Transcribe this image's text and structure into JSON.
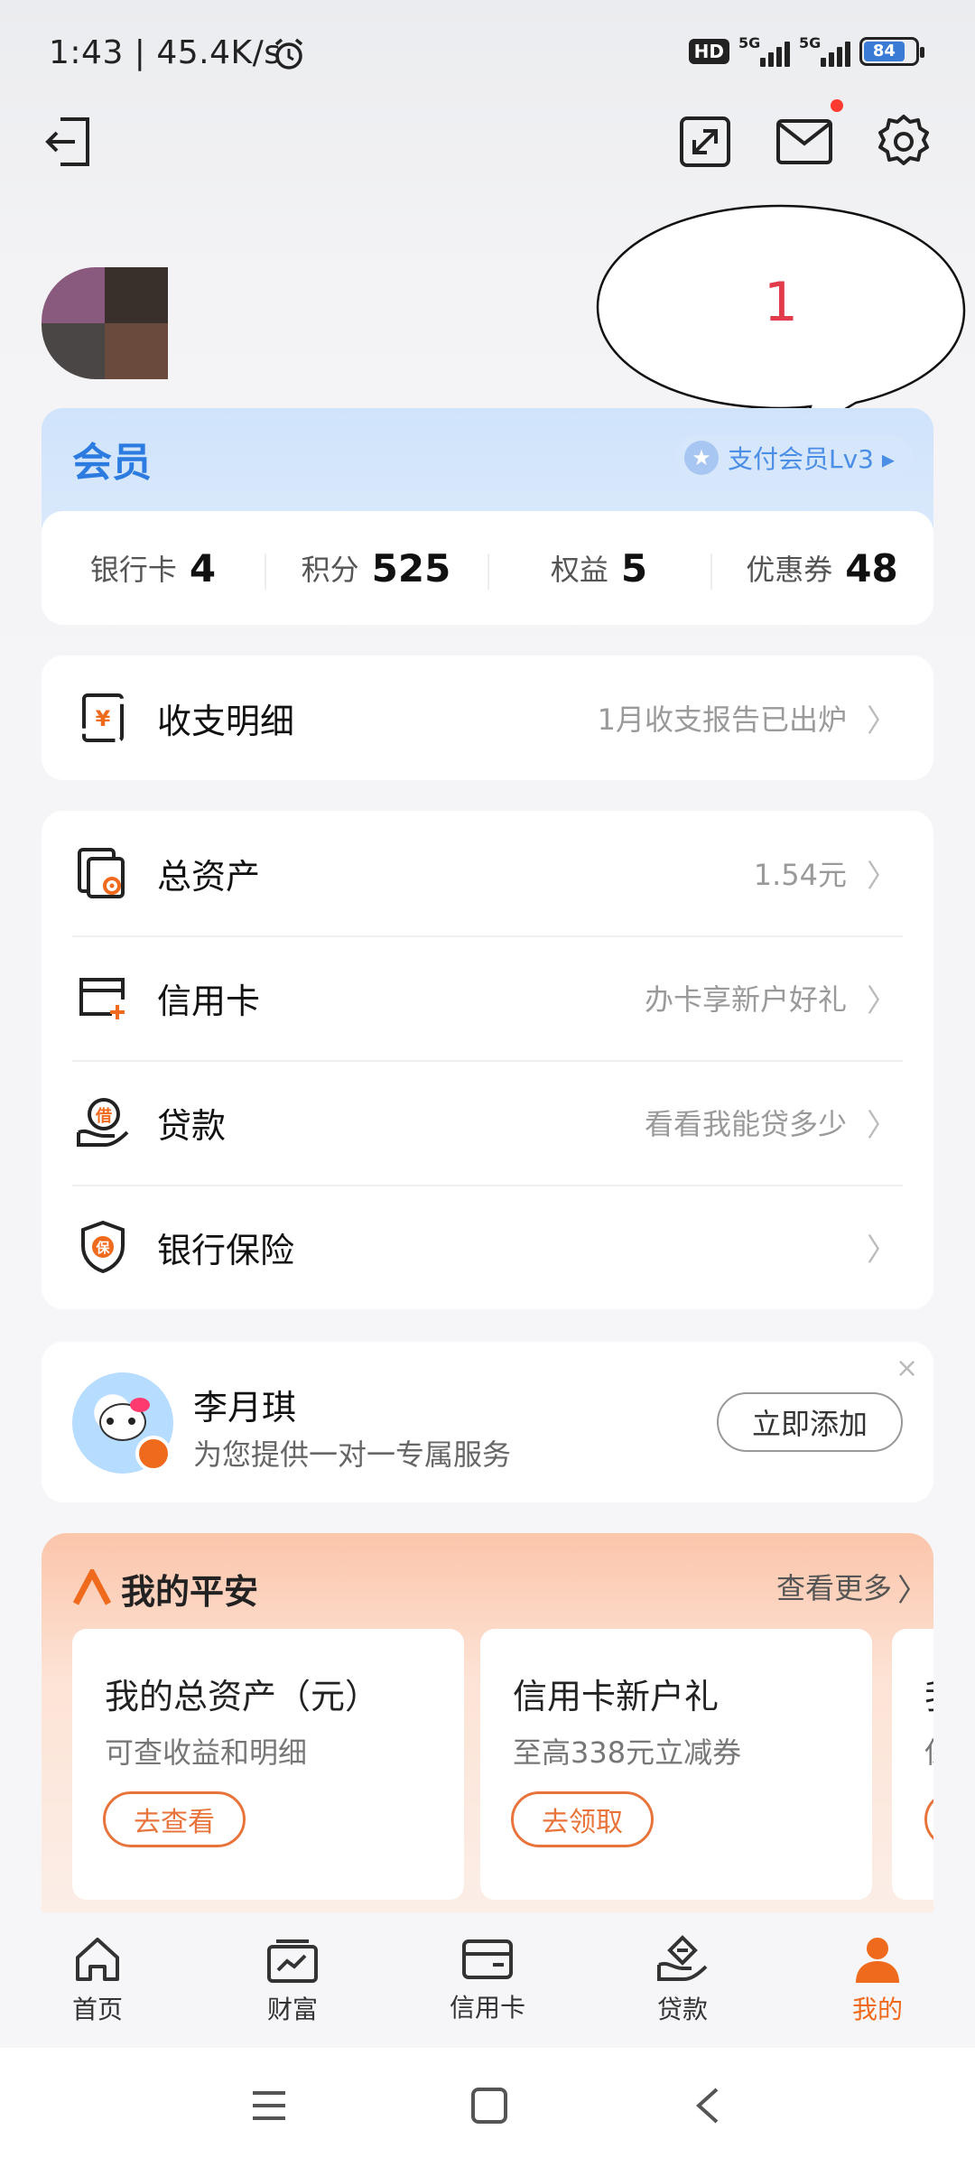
{
  "status_bar": {
    "time": "1:43 | 45.4K/s",
    "hd_label": "HD",
    "net1": "5G",
    "net2": "5G",
    "battery": "84"
  },
  "bubble": {
    "text": "1"
  },
  "member": {
    "title": "会员",
    "level": "支付会员Lv3 ▸",
    "stats": [
      {
        "label": "银行卡",
        "value": "4"
      },
      {
        "label": "积分",
        "value": "525"
      },
      {
        "label": "权益",
        "value": "5"
      },
      {
        "label": "优惠券",
        "value": "48"
      }
    ]
  },
  "statement": {
    "title": "收支明细",
    "hint": "1月收支报告已出炉"
  },
  "menu": [
    {
      "title": "总资产",
      "hint": "1.54元"
    },
    {
      "title": "信用卡",
      "hint": "办卡享新户好礼"
    },
    {
      "title": "贷款",
      "hint": "看看我能贷多少"
    },
    {
      "title": "银行保险",
      "hint": ""
    }
  ],
  "advisor": {
    "name": "李月琪",
    "subtitle": "为您提供一对一专属服务",
    "button": "立即添加"
  },
  "my_pingan": {
    "title": "我的平安",
    "more": "查看更多",
    "tiles": [
      {
        "title": "我的总资产（元）",
        "subtitle": "可查收益和明细",
        "button": "去查看"
      },
      {
        "title": "信用卡新户礼",
        "subtitle": "至高338元立减券",
        "button": "去领取"
      },
      {
        "title": "我",
        "subtitle": "保",
        "button": ""
      }
    ]
  },
  "bottom_nav": [
    {
      "label": "首页",
      "icon": "home-icon"
    },
    {
      "label": "财富",
      "icon": "wealth-icon"
    },
    {
      "label": "信用卡",
      "icon": "credit-card-icon"
    },
    {
      "label": "贷款",
      "icon": "loan-icon"
    },
    {
      "label": "我的",
      "icon": "person-icon"
    }
  ],
  "colors": {
    "accent_orange": "#f06a1d",
    "member_blue": "#2b7be0",
    "bubble_red": "#e23b4b"
  }
}
